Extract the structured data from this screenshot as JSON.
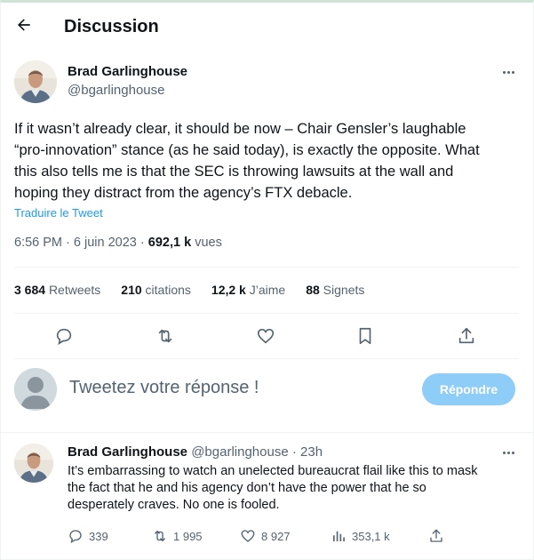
{
  "header": {
    "title": "Discussion",
    "back_icon": "arrow-left-icon"
  },
  "tweet": {
    "author_name": "Brad Garlinghouse",
    "author_handle": "@bgarlinghouse",
    "text_lines": [
      "If it wasn’t already clear, it should be now – Chair Gensler’s laughable",
      "“pro-innovation” stance (as he said today), is exactly the opposite. What",
      "this also tells me is that the SEC is throwing lawsuits at the wall and",
      "hoping they distract from the agency’s FTX debacle."
    ],
    "translate_label": "Traduire le Tweet",
    "time": "6:56 PM",
    "separator": "·",
    "date": "6 juin 2023",
    "views_count": "692,1 k",
    "views_label": "vues",
    "stats": {
      "retweets_count": "3 684",
      "retweets_label": "Retweets",
      "quotes_count": "210",
      "quotes_label": "citations",
      "likes_count": "12,2 k",
      "likes_label": "J’aime",
      "bookmarks_count": "88",
      "bookmarks_label": "Signets"
    }
  },
  "reply_box": {
    "placeholder": "Tweetez votre réponse !",
    "button_label": "Répondre"
  },
  "reply": {
    "author_name": "Brad Garlinghouse",
    "author_handle": "@bgarlinghouse",
    "separator": "·",
    "time": "23h",
    "text_lines": [
      "It’s embarrassing to watch an unelected bureaucrat flail like this to mask",
      "the fact that he and his agency don’t have the power that he so",
      "desperately craves. No one is fooled."
    ],
    "replies_count": "339",
    "retweets_count": "1 995",
    "likes_count": "8 927",
    "views_count": "353,1 k"
  },
  "colors": {
    "accent": "#1d9bf0",
    "button_disabled": "#8ecdf8",
    "muted_text": "#536471",
    "text": "#0f1419"
  }
}
